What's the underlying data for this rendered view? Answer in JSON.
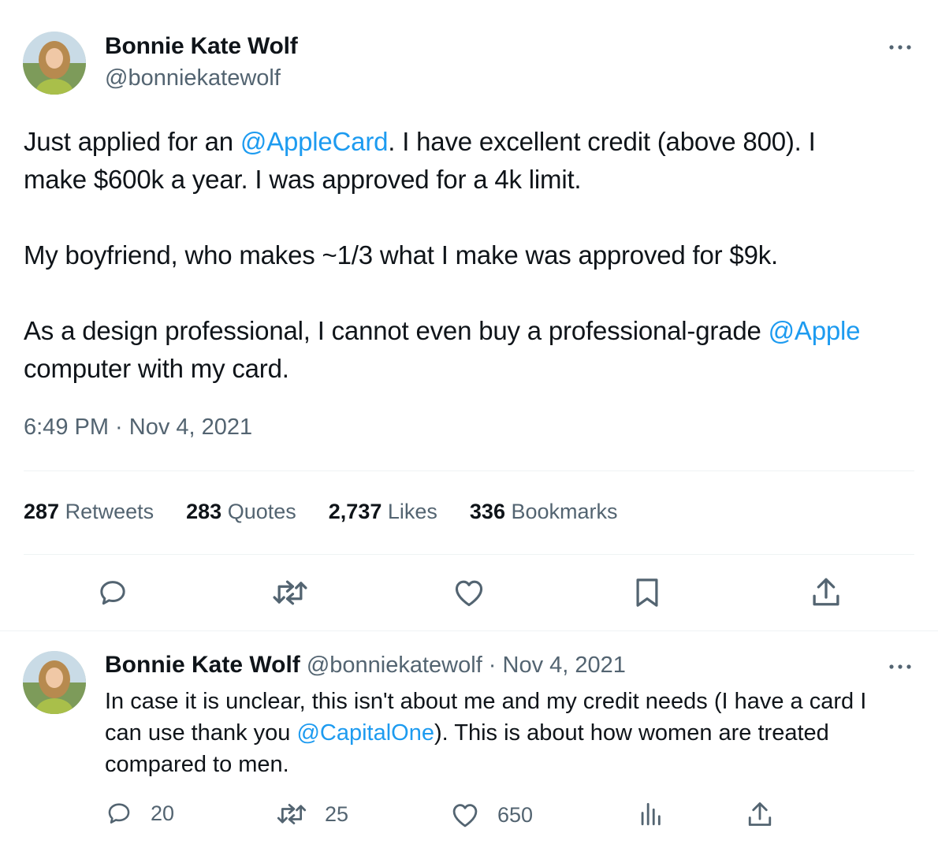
{
  "tweet": {
    "author_name": "Bonnie Kate Wolf",
    "author_handle": "@bonniekatewolf",
    "line1": {
      "a": "Just applied for an ",
      "mention": "@AppleCard",
      "b": ". I have excellent credit (above 800). I"
    },
    "line2": "make $600k a year. I was approved for a 4k limit.",
    "line3": "My boyfriend, who makes ~1/3 what I make was approved for $9k.",
    "line4": {
      "a": "As a design professional, I cannot even buy a professional-grade ",
      "mention": "@Apple"
    },
    "line5": "computer with my card.",
    "timestamp": "6:49 PM · Nov 4, 2021",
    "stats": [
      {
        "value": "287",
        "label": "Retweets"
      },
      {
        "value": "283",
        "label": "Quotes"
      },
      {
        "value": "2,737",
        "label": "Likes"
      },
      {
        "value": "336",
        "label": "Bookmarks"
      }
    ],
    "icons": [
      "reply-icon",
      "retweet-icon",
      "like-icon",
      "bookmark-icon",
      "share-icon"
    ]
  },
  "reply": {
    "author_name": "Bonnie Kate Wolf",
    "meta": "@bonniekatewolf · Nov 4, 2021",
    "line1": "In case it is unclear, this isn't about me and my credit needs (I have a card I",
    "line2": {
      "a": "can use thank you ",
      "mention": "@CapitalOne",
      "b": "). This is about how women are treated"
    },
    "line3": "compared to men.",
    "counts": {
      "replies": "20",
      "retweets": "25",
      "likes": "650"
    }
  },
  "colors": {
    "text": "#0f1419",
    "secondary": "#536471",
    "link": "#1d9bf0",
    "divider": "#eff3f4"
  }
}
